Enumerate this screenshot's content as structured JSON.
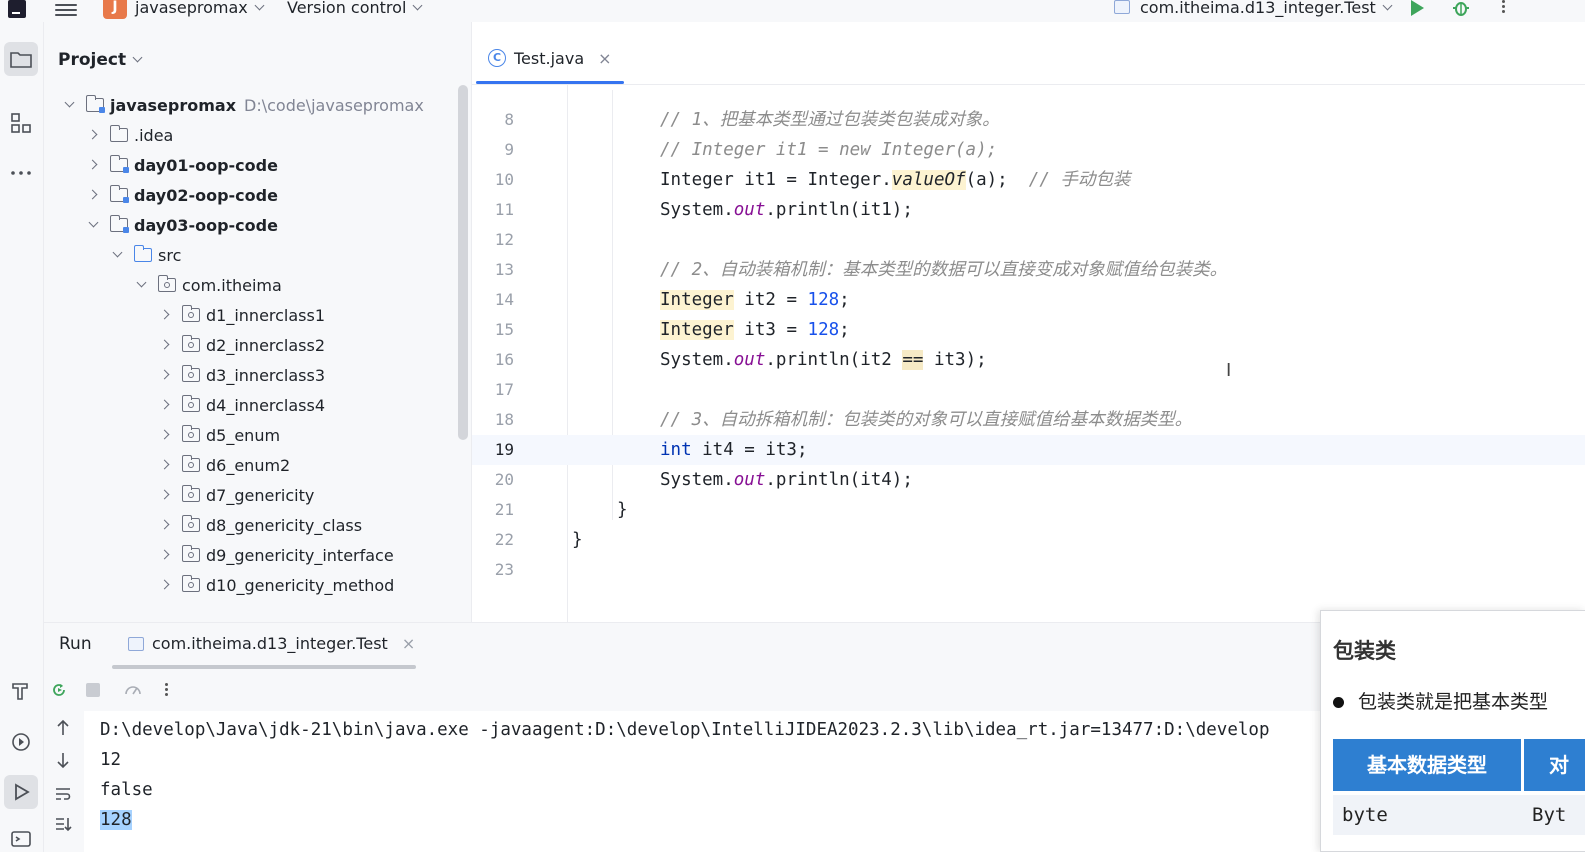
{
  "topbar": {
    "project_badge": "J",
    "project_name": "javasepromax",
    "vcs_label": "Version control",
    "run_config": "com.itheima.d13_integer.Test"
  },
  "project_panel": {
    "title": "Project",
    "tree": [
      {
        "label": "javasepromax",
        "hint": "D:\\code\\javasepromax",
        "depth": 0,
        "open": true,
        "kind": "mod",
        "bold": true
      },
      {
        "label": ".idea",
        "depth": 1,
        "open": false,
        "kind": "folder",
        "bold": false
      },
      {
        "label": "day01-oop-code",
        "depth": 1,
        "open": false,
        "kind": "mod",
        "bold": true
      },
      {
        "label": "day02-oop-code",
        "depth": 1,
        "open": false,
        "kind": "mod",
        "bold": true
      },
      {
        "label": "day03-oop-code",
        "depth": 1,
        "open": true,
        "kind": "mod",
        "bold": true
      },
      {
        "label": "src",
        "depth": 2,
        "open": true,
        "kind": "src",
        "bold": false
      },
      {
        "label": "com.itheima",
        "depth": 3,
        "open": true,
        "kind": "pkg",
        "bold": false
      },
      {
        "label": "d1_innerclass1",
        "depth": 4,
        "open": false,
        "kind": "pkg",
        "bold": false
      },
      {
        "label": "d2_innerclass2",
        "depth": 4,
        "open": false,
        "kind": "pkg",
        "bold": false
      },
      {
        "label": "d3_innerclass3",
        "depth": 4,
        "open": false,
        "kind": "pkg",
        "bold": false
      },
      {
        "label": "d4_innerclass4",
        "depth": 4,
        "open": false,
        "kind": "pkg",
        "bold": false
      },
      {
        "label": "d5_enum",
        "depth": 4,
        "open": false,
        "kind": "pkg",
        "bold": false
      },
      {
        "label": "d6_enum2",
        "depth": 4,
        "open": false,
        "kind": "pkg",
        "bold": false
      },
      {
        "label": "d7_genericity",
        "depth": 4,
        "open": false,
        "kind": "pkg",
        "bold": false
      },
      {
        "label": "d8_genericity_class",
        "depth": 4,
        "open": false,
        "kind": "pkg",
        "bold": false
      },
      {
        "label": "d9_genericity_interface",
        "depth": 4,
        "open": false,
        "kind": "pkg",
        "bold": false
      },
      {
        "label": "d10_genericity_method",
        "depth": 4,
        "open": false,
        "kind": "pkg",
        "bold": false
      }
    ]
  },
  "editor": {
    "tab_label": "Test.java",
    "tab_icon_glyph": "C",
    "current_line": 19,
    "lines": [
      {
        "n": "8",
        "indent": 2,
        "tokens": [
          {
            "t": "// 1、把基本类型通过包装类包装成对象。",
            "c": "cm"
          }
        ]
      },
      {
        "n": "9",
        "indent": 2,
        "tokens": [
          {
            "t": "// Integer it1 = new Integer(a);",
            "c": "cm"
          }
        ]
      },
      {
        "n": "10",
        "indent": 2,
        "tokens": [
          {
            "t": "Integer it1 = Integer.",
            "c": ""
          },
          {
            "t": "valueOf",
            "c": "mth hl"
          },
          {
            "t": "(a);  ",
            "c": ""
          },
          {
            "t": "// 手动包装",
            "c": "cm"
          }
        ]
      },
      {
        "n": "11",
        "indent": 2,
        "tokens": [
          {
            "t": "System.",
            "c": ""
          },
          {
            "t": "out",
            "c": "fld"
          },
          {
            "t": ".println(it1);",
            "c": ""
          }
        ]
      },
      {
        "n": "12",
        "indent": 2,
        "tokens": []
      },
      {
        "n": "13",
        "indent": 2,
        "tokens": [
          {
            "t": "// 2、自动装箱机制：基本类型的数据可以直接变成对象赋值给包装类。",
            "c": "cm"
          }
        ]
      },
      {
        "n": "14",
        "indent": 2,
        "tokens": [
          {
            "t": "Integer",
            "c": "hl"
          },
          {
            "t": " it2 = ",
            "c": ""
          },
          {
            "t": "128",
            "c": "num"
          },
          {
            "t": ";",
            "c": ""
          }
        ]
      },
      {
        "n": "15",
        "indent": 2,
        "tokens": [
          {
            "t": "Integer",
            "c": "hl"
          },
          {
            "t": " it3 = ",
            "c": ""
          },
          {
            "t": "128",
            "c": "num"
          },
          {
            "t": ";",
            "c": ""
          }
        ]
      },
      {
        "n": "16",
        "indent": 2,
        "tokens": [
          {
            "t": "System.",
            "c": ""
          },
          {
            "t": "out",
            "c": "fld"
          },
          {
            "t": ".println(it2 ",
            "c": ""
          },
          {
            "t": "==",
            "c": "hl2"
          },
          {
            "t": " it3);",
            "c": ""
          }
        ]
      },
      {
        "n": "17",
        "indent": 2,
        "tokens": []
      },
      {
        "n": "18",
        "indent": 2,
        "tokens": [
          {
            "t": "// 3、自动拆箱机制：包装类的对象可以直接赋值给基本数据类型。",
            "c": "cm"
          }
        ]
      },
      {
        "n": "19",
        "indent": 2,
        "tokens": [
          {
            "t": "int",
            "c": "kw"
          },
          {
            "t": " it4 = it3;",
            "c": ""
          }
        ]
      },
      {
        "n": "20",
        "indent": 2,
        "tokens": [
          {
            "t": "System.",
            "c": ""
          },
          {
            "t": "out",
            "c": "fld"
          },
          {
            "t": ".println(it4);",
            "c": ""
          }
        ]
      },
      {
        "n": "21",
        "indent": 1,
        "tokens": [
          {
            "t": "}",
            "c": ""
          }
        ]
      },
      {
        "n": "22",
        "indent": 0,
        "tokens": [
          {
            "t": "}",
            "c": ""
          }
        ]
      },
      {
        "n": "23",
        "indent": 0,
        "tokens": []
      }
    ]
  },
  "run_panel": {
    "title": "Run",
    "tab_label": "com.itheima.d13_integer.Test",
    "console": [
      {
        "text": "D:\\develop\\Java\\jdk-21\\bin\\java.exe -javaagent:D:\\develop\\IntelliJIDEA2023.2.3\\lib\\idea_rt.jar=13477:D:\\develop",
        "selected": false
      },
      {
        "text": "12",
        "selected": false
      },
      {
        "text": "false",
        "selected": false
      },
      {
        "text": "128",
        "selected": true
      }
    ]
  },
  "popup": {
    "title": "包装类",
    "bullet": "包装类就是把基本类型",
    "header_col1": "基本数据类型",
    "header_col2": "对",
    "row_col1": "byte",
    "row_col2": "Byt"
  },
  "colors": {
    "accent": "#3574f0",
    "popup_header": "#2e7fd1",
    "run_green": "#3ea55b",
    "comment": "#8c8c8c",
    "keyword": "#0033b3",
    "number": "#1750eb",
    "field": "#871094"
  }
}
